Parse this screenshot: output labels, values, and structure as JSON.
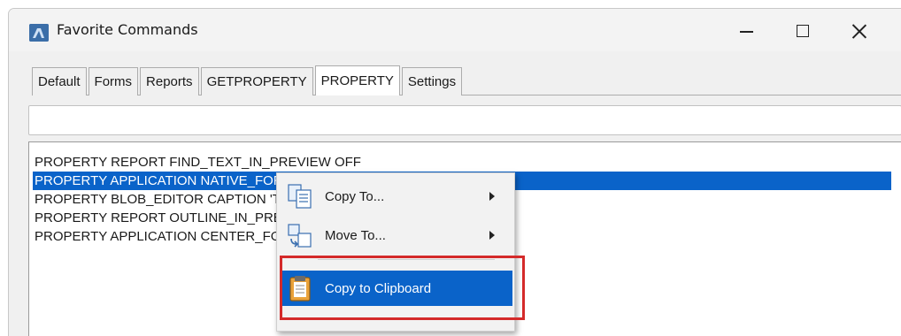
{
  "window": {
    "title": "Favorite Commands",
    "controls": {
      "minimize": "minimize",
      "maximize": "maximize",
      "close": "close"
    }
  },
  "tabs": [
    {
      "label": "Default"
    },
    {
      "label": "Forms"
    },
    {
      "label": "Reports"
    },
    {
      "label": "GETPROPERTY"
    },
    {
      "label": "PROPERTY",
      "active": true
    },
    {
      "label": "Settings"
    }
  ],
  "command_input": {
    "value": ""
  },
  "list": {
    "items": [
      {
        "text": "PROPERTY REPORT FIND_TEXT_IN_PREVIEW OFF"
      },
      {
        "text": "PROPERTY APPLICATION NATIVE_FORMS OFF",
        "selected": true
      },
      {
        "text": "PROPERTY BLOB_EDITOR CAPTION 'The editor you've always wanted!'"
      },
      {
        "text": "PROPERTY REPORT OUTLINE_IN_PREVIEW ON"
      },
      {
        "text": "PROPERTY APPLICATION CENTER_FORMS ON"
      }
    ]
  },
  "context_menu": {
    "items": [
      {
        "label": "Copy To...",
        "icon": "copy-to-icon",
        "submenu": true
      },
      {
        "label": "Move To...",
        "icon": "move-to-icon",
        "submenu": true
      },
      {
        "label": "Copy to Clipboard",
        "icon": "clipboard-icon",
        "highlighted": true
      }
    ]
  },
  "colors": {
    "selection": "#0a63c9",
    "annotation_box": "#d42a2a"
  }
}
